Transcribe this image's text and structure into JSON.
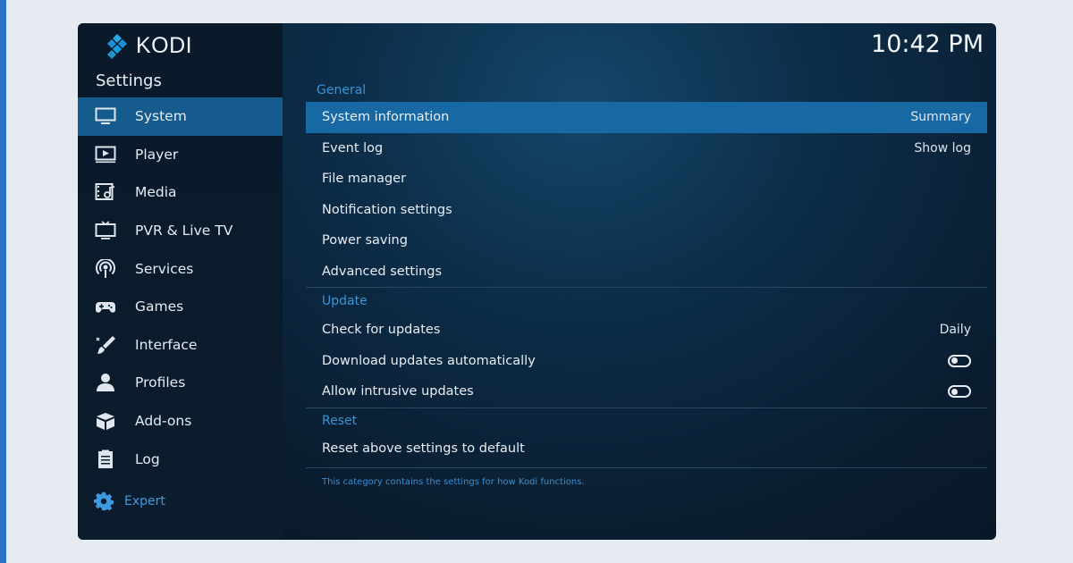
{
  "app": {
    "name": "KODI",
    "clock": "10:42 PM",
    "page_title": "Settings"
  },
  "colors": {
    "accent": "#3b94d6",
    "selected": "#1869a3",
    "active_nav": "#165b8d"
  },
  "sidebar": {
    "items": [
      {
        "label": "System",
        "icon": "monitor-icon",
        "active": true
      },
      {
        "label": "Player",
        "icon": "play-icon"
      },
      {
        "label": "Media",
        "icon": "media-icon"
      },
      {
        "label": "PVR & Live TV",
        "icon": "tv-icon"
      },
      {
        "label": "Services",
        "icon": "broadcast-icon"
      },
      {
        "label": "Games",
        "icon": "gamepad-icon"
      },
      {
        "label": "Interface",
        "icon": "brush-icon"
      },
      {
        "label": "Profiles",
        "icon": "user-icon"
      },
      {
        "label": "Add-ons",
        "icon": "box-icon"
      },
      {
        "label": "Log",
        "icon": "clipboard-icon"
      }
    ],
    "expert_label": "Expert"
  },
  "sections": {
    "general": {
      "header": "General",
      "rows": [
        {
          "label": "System information",
          "value": "Summary"
        },
        {
          "label": "Event log",
          "value": "Show log"
        },
        {
          "label": "File manager",
          "value": ""
        },
        {
          "label": "Notification settings",
          "value": ""
        },
        {
          "label": "Power saving",
          "value": ""
        },
        {
          "label": "Advanced settings",
          "value": ""
        }
      ]
    },
    "update": {
      "header": "Update",
      "rows": [
        {
          "label": "Check for updates",
          "value": "Daily"
        },
        {
          "label": "Download updates automatically",
          "toggle": "off"
        },
        {
          "label": "Allow intrusive updates",
          "toggle": "off"
        }
      ]
    },
    "reset": {
      "header": "Reset",
      "rows": [
        {
          "label": "Reset above settings to default"
        }
      ]
    }
  },
  "footnote": "This category contains the settings for how Kodi functions."
}
